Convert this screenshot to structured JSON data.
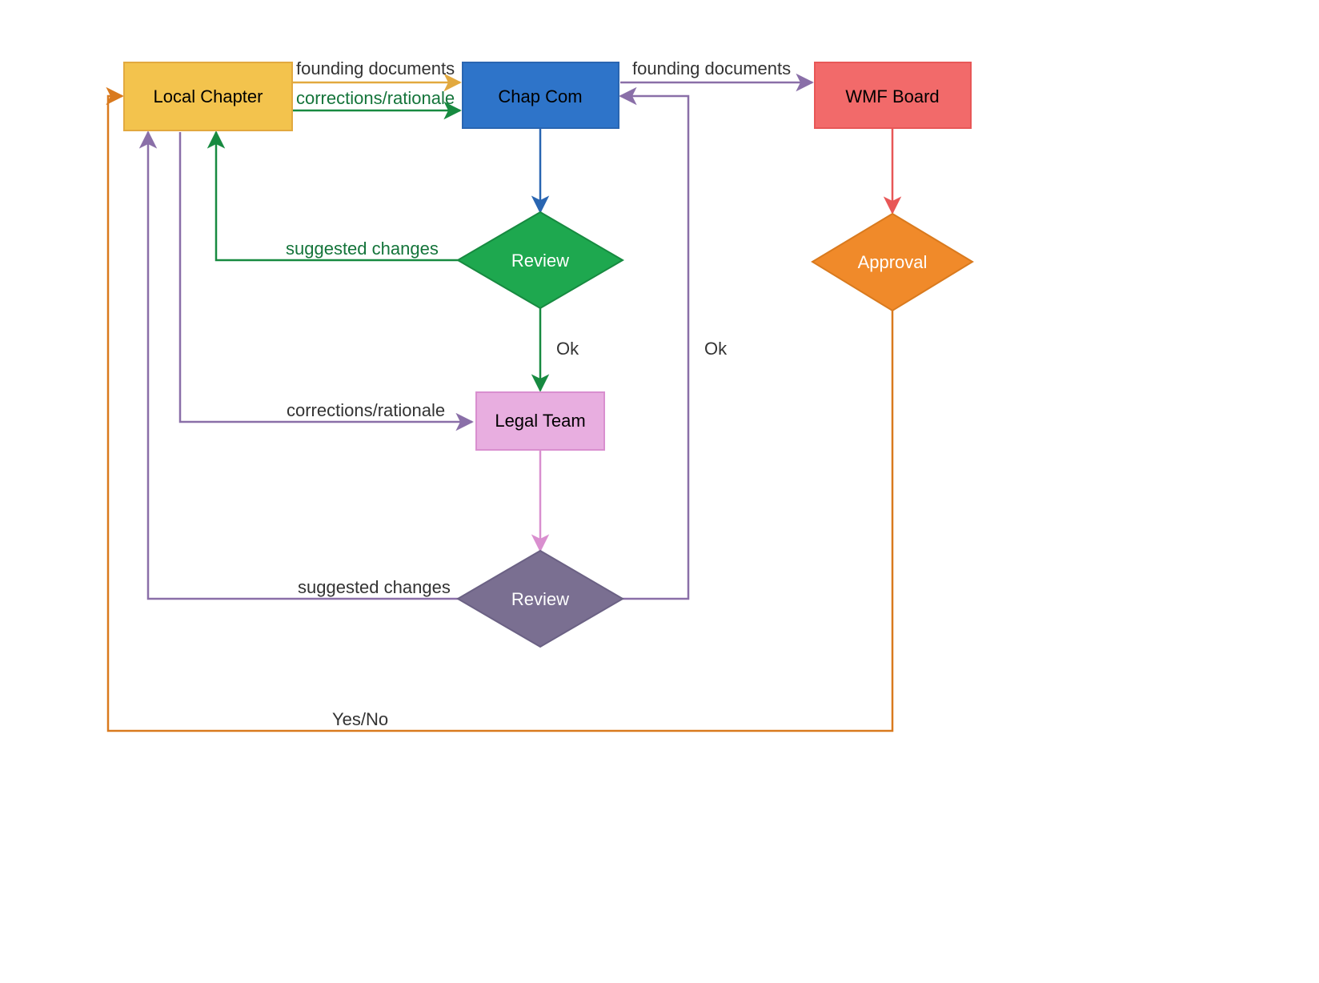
{
  "nodes": {
    "local_chapter": {
      "label": "Local Chapter"
    },
    "chap_com": {
      "label": "Chap Com"
    },
    "wmf_board": {
      "label": "WMF Board"
    },
    "review1": {
      "label": "Review"
    },
    "legal_team": {
      "label": "Legal Team"
    },
    "review2": {
      "label": "Review"
    },
    "approval": {
      "label": "Approval"
    }
  },
  "edges": {
    "lc_cc_founding": {
      "label": "founding documents"
    },
    "lc_cc_corrections": {
      "label": "corrections/rationale"
    },
    "cc_wmf_founding": {
      "label": "founding documents"
    },
    "r1_lc_suggested": {
      "label": "suggested changes"
    },
    "r1_lt_ok": {
      "label": "Ok"
    },
    "lc_lt_corrections": {
      "label": "corrections/rationale"
    },
    "r2_lc_suggested": {
      "label": "suggested changes"
    },
    "r2_cc_ok": {
      "label": "Ok"
    },
    "app_lc_yesno": {
      "label": "Yes/No"
    }
  },
  "colors": {
    "yellow": "#f3c34d",
    "blue": "#2e74c9",
    "salmon": "#f26a6a",
    "green": "#1ea84f",
    "pink": "#e8aee0",
    "purple": "#7a6f91",
    "orange": "#f08a2a",
    "strokeYellow": "#e2a93f",
    "strokeBlue": "#2965b1",
    "strokeSalmon": "#e85757",
    "strokeGreen": "#178a40",
    "strokePink": "#d98fcf",
    "strokePurple": "#6b6184",
    "strokeOrange": "#d97a1e",
    "lineViolet": "#8a6fa8"
  }
}
